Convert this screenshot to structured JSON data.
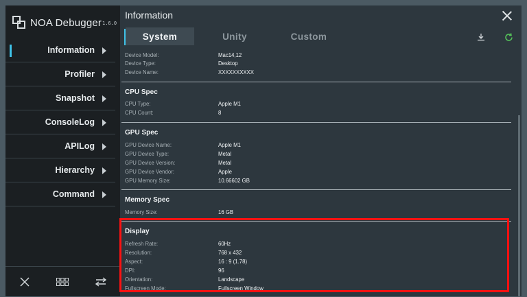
{
  "app": {
    "name": "NOA Debugger",
    "version": "1.6.0"
  },
  "sidebar": {
    "items": [
      {
        "label": "Information"
      },
      {
        "label": "Profiler"
      },
      {
        "label": "Snapshot"
      },
      {
        "label": "ConsoleLog"
      },
      {
        "label": "APILog"
      },
      {
        "label": "Hierarchy"
      },
      {
        "label": "Command"
      }
    ],
    "bottom_icons": [
      "close-icon",
      "grid-icon",
      "swap-icon"
    ]
  },
  "header": {
    "title": "Information"
  },
  "tabs": [
    {
      "label": "System"
    },
    {
      "label": "Unity"
    },
    {
      "label": "Custom"
    }
  ],
  "toolbar_icons": [
    "download-icon",
    "refresh-icon"
  ],
  "colors": {
    "accent": "#3fc2e8",
    "refresh": "#55c45a",
    "highlight": "#ff1111"
  },
  "sections": {
    "device": {
      "rows": [
        {
          "label": "Device Model:",
          "value": "Mac14,12"
        },
        {
          "label": "Device Type:",
          "value": "Desktop"
        },
        {
          "label": "Device Name:",
          "value": "XXXXXXXXXX"
        }
      ]
    },
    "cpu": {
      "title": "CPU Spec",
      "rows": [
        {
          "label": "CPU Type:",
          "value": "Apple M1"
        },
        {
          "label": "CPU Count:",
          "value": "8"
        }
      ]
    },
    "gpu": {
      "title": "GPU Spec",
      "rows": [
        {
          "label": "GPU Device Name:",
          "value": "Apple M1"
        },
        {
          "label": "GPU Device Type:",
          "value": "Metal"
        },
        {
          "label": "GPU Device Version:",
          "value": "Metal"
        },
        {
          "label": "GPU Device Vendor:",
          "value": "Apple"
        },
        {
          "label": "GPU Memory Size:",
          "value": "10.66602 GB"
        }
      ]
    },
    "memory": {
      "title": "Memory Spec",
      "rows": [
        {
          "label": "Memory Size:",
          "value": "16 GB"
        }
      ]
    },
    "display": {
      "title": "Display",
      "rows": [
        {
          "label": "Refresh Rate:",
          "value": "60Hz"
        },
        {
          "label": "Resolution:",
          "value": "768 x 432"
        },
        {
          "label": "Aspect:",
          "value": "16 : 9 (1.78)"
        },
        {
          "label": "DPI:",
          "value": "96"
        },
        {
          "label": "Orientation:",
          "value": "Landscape"
        },
        {
          "label": "Fullscreen Mode:",
          "value": "Fullscreen Window"
        }
      ]
    }
  }
}
